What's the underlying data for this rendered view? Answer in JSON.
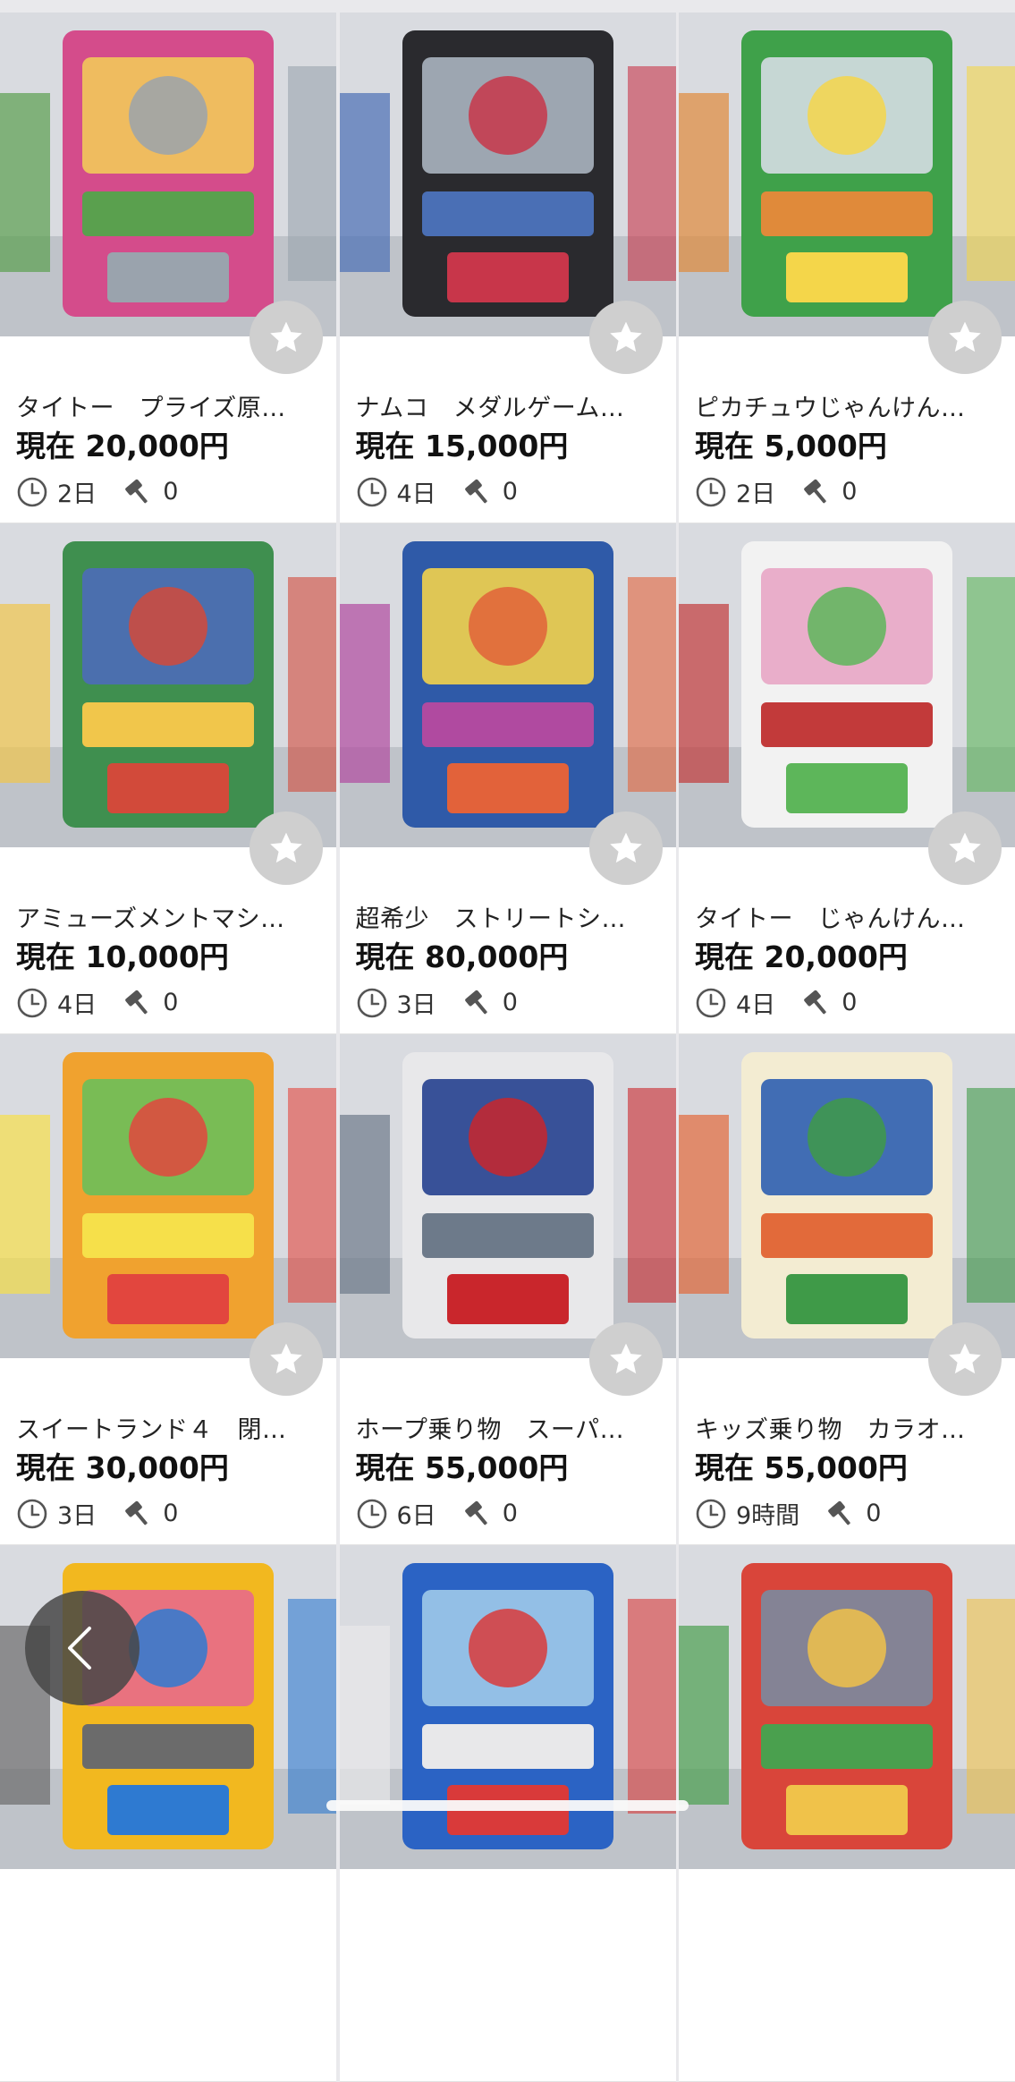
{
  "listings": [
    {
      "title": "タイトー　プライズ原…",
      "price": "現在 20,000円",
      "time_left": "2日",
      "bids": "0",
      "palette": [
        "#d44c8b",
        "#9aa3ad",
        "#f2c95a",
        "#5aa04e"
      ]
    },
    {
      "title": "ナムコ　メダルゲーム…",
      "price": "現在 15,000円",
      "time_left": "4日",
      "bids": "0",
      "palette": [
        "#2a2a2e",
        "#c8364a",
        "#aab4c0",
        "#4a6fb5"
      ]
    },
    {
      "title": "ピカチュウじゃんけん…",
      "price": "現在 5,000円",
      "time_left": "2日",
      "bids": "0",
      "palette": [
        "#3fa14a",
        "#f4d64a",
        "#d5dde3",
        "#e08a3a"
      ]
    },
    {
      "title": "アミューズメントマシ…",
      "price": "現在 10,000円",
      "time_left": "4日",
      "bids": "0",
      "palette": [
        "#3f8f4f",
        "#d24a3a",
        "#4c6bb8",
        "#f1c64b"
      ]
    },
    {
      "title": "超希少　ストリートシ…",
      "price": "現在 80,000円",
      "time_left": "3日",
      "bids": "0",
      "palette": [
        "#2f5aa8",
        "#e2623a",
        "#f3d24b",
        "#b04aa0"
      ]
    },
    {
      "title": "タイトー　じゃんけん…",
      "price": "現在 20,000円",
      "time_left": "4日",
      "bids": "0",
      "palette": [
        "#f2f2f2",
        "#5db65a",
        "#e8a6c5",
        "#c23a3a"
      ]
    },
    {
      "title": "スイートランド４　閉…",
      "price": "現在 30,000円",
      "time_left": "3日",
      "bids": "0",
      "palette": [
        "#f0a22f",
        "#e2463e",
        "#6cbf5a",
        "#f6e04a"
      ]
    },
    {
      "title": "ホープ乗り物　スーパ…",
      "price": "現在 55,000円",
      "time_left": "6日",
      "bids": "0",
      "palette": [
        "#e8e8ea",
        "#c9262c",
        "#25408f",
        "#6d7a8a"
      ]
    },
    {
      "title": "キッズ乗り物　カラオ…",
      "price": "現在 55,000円",
      "time_left": "9時間",
      "bids": "0",
      "palette": [
        "#f3ecd2",
        "#3f9a48",
        "#2d5fb0",
        "#e26a3a"
      ]
    },
    {
      "title": "",
      "price": "",
      "time_left": "",
      "bids": "",
      "palette": [
        "#f2b81f",
        "#2e7ad1",
        "#e86a8a",
        "#6b6b6b"
      ]
    },
    {
      "title": "",
      "price": "",
      "time_left": "",
      "bids": "",
      "palette": [
        "#2b63c4",
        "#d93a3a",
        "#9fc9ea",
        "#e8e8ea"
      ]
    },
    {
      "title": "",
      "price": "",
      "time_left": "",
      "bids": "",
      "palette": [
        "#d9453a",
        "#f0c24a",
        "#7a8aa0",
        "#4aa04e"
      ]
    }
  ],
  "colors": {
    "background": "#e9e9ec",
    "card": "#ffffff",
    "favorite_button": "#cfcfcf",
    "meta_icon": "#555555"
  },
  "icons": {
    "favorite": "star-icon",
    "time": "clock-icon",
    "bids": "gavel-icon",
    "back": "chevron-left-icon"
  }
}
